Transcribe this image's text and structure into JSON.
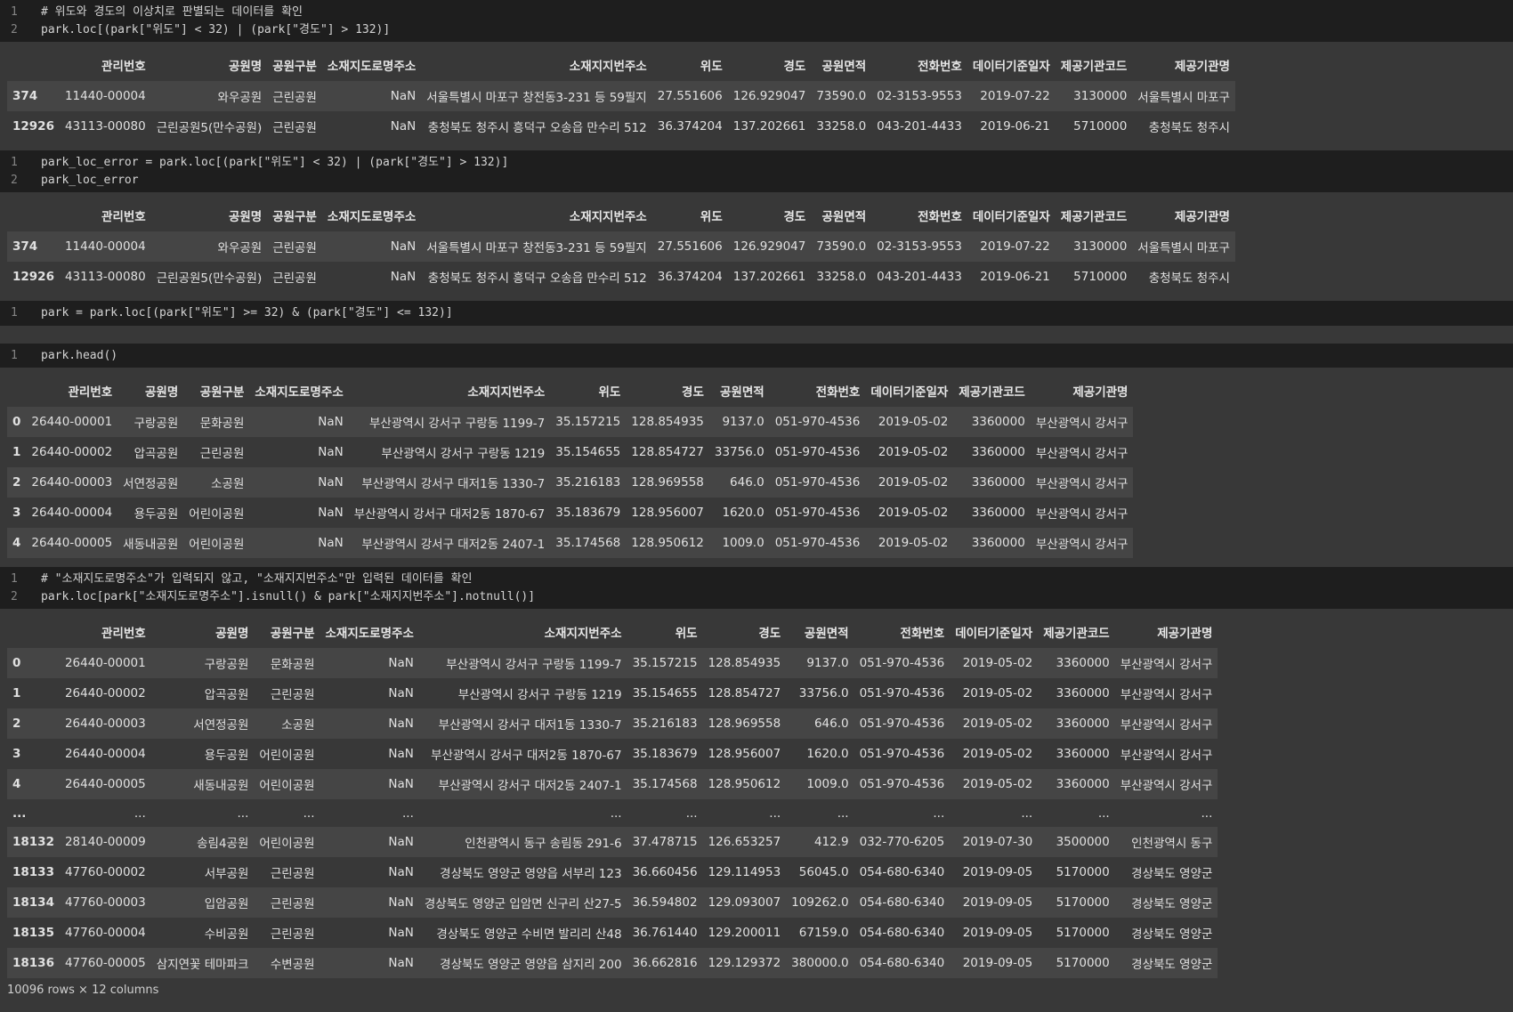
{
  "columns": [
    "관리번호",
    "공원명",
    "공원구분",
    "소재지도로명주소",
    "소재지지번주소",
    "위도",
    "경도",
    "공원면적",
    "전화번호",
    "데이터기준일자",
    "제공기관코드",
    "제공기관명"
  ],
  "cells": [
    {
      "code": [
        {
          "n": "1",
          "t": "# 위도와 경도의 이상치로 판별되는 데이터를 확인"
        },
        {
          "n": "2",
          "t": "park.loc[(park[\"위도\"] < 32) | (park[\"경도\"] > 132)]"
        }
      ],
      "rows": [
        [
          "374",
          "11440-00004",
          "와우공원",
          "근린공원",
          "NaN",
          "서울특별시 마포구 창전동3-231 등 59필지",
          "27.551606",
          "126.929047",
          "73590.0",
          "02-3153-9553",
          "2019-07-22",
          "3130000",
          "서울특별시 마포구"
        ],
        [
          "12926",
          "43113-00080",
          "근린공원5(만수공원)",
          "근린공원",
          "NaN",
          "충청북도 청주시 흥덕구 오송읍 만수리 512",
          "36.374204",
          "137.202661",
          "33258.0",
          "043-201-4433",
          "2019-06-21",
          "5710000",
          "충청북도 청주시"
        ]
      ]
    },
    {
      "code": [
        {
          "n": "1",
          "t": "park_loc_error = park.loc[(park[\"위도\"] < 32) | (park[\"경도\"] > 132)]"
        },
        {
          "n": "2",
          "t": "park_loc_error"
        }
      ],
      "rows": [
        [
          "374",
          "11440-00004",
          "와우공원",
          "근린공원",
          "NaN",
          "서울특별시 마포구 창전동3-231 등 59필지",
          "27.551606",
          "126.929047",
          "73590.0",
          "02-3153-9553",
          "2019-07-22",
          "3130000",
          "서울특별시 마포구"
        ],
        [
          "12926",
          "43113-00080",
          "근린공원5(만수공원)",
          "근린공원",
          "NaN",
          "충청북도 청주시 흥덕구 오송읍 만수리 512",
          "36.374204",
          "137.202661",
          "33258.0",
          "043-201-4433",
          "2019-06-21",
          "5710000",
          "충청북도 청주시"
        ]
      ]
    },
    {
      "code": [
        {
          "n": "1",
          "t": "park = park.loc[(park[\"위도\"] >= 32) & (park[\"경도\"] <= 132)]"
        }
      ]
    },
    {
      "code": [
        {
          "n": "1",
          "t": "park.head()"
        }
      ],
      "rows": [
        [
          "0",
          "26440-00001",
          "구랑공원",
          "문화공원",
          "NaN",
          "부산광역시 강서구 구랑동 1199-7",
          "35.157215",
          "128.854935",
          "9137.0",
          "051-970-4536",
          "2019-05-02",
          "3360000",
          "부산광역시 강서구"
        ],
        [
          "1",
          "26440-00002",
          "압곡공원",
          "근린공원",
          "NaN",
          "부산광역시 강서구 구랑동 1219",
          "35.154655",
          "128.854727",
          "33756.0",
          "051-970-4536",
          "2019-05-02",
          "3360000",
          "부산광역시 강서구"
        ],
        [
          "2",
          "26440-00003",
          "서연정공원",
          "소공원",
          "NaN",
          "부산광역시 강서구 대저1동 1330-7",
          "35.216183",
          "128.969558",
          "646.0",
          "051-970-4536",
          "2019-05-02",
          "3360000",
          "부산광역시 강서구"
        ],
        [
          "3",
          "26440-00004",
          "용두공원",
          "어린이공원",
          "NaN",
          "부산광역시 강서구 대저2동 1870-67",
          "35.183679",
          "128.956007",
          "1620.0",
          "051-970-4536",
          "2019-05-02",
          "3360000",
          "부산광역시 강서구"
        ],
        [
          "4",
          "26440-00005",
          "새동내공원",
          "어린이공원",
          "NaN",
          "부산광역시 강서구 대저2동 2407-1",
          "35.174568",
          "128.950612",
          "1009.0",
          "051-970-4536",
          "2019-05-02",
          "3360000",
          "부산광역시 강서구"
        ]
      ]
    },
    {
      "code": [
        {
          "n": "1",
          "t": "# \"소재지도로명주소\"가 입력되지 않고, \"소재지지번주소\"만 입력된 데이터를 확인"
        },
        {
          "n": "2",
          "t": "park.loc[park[\"소재지도로명주소\"].isnull() & park[\"소재지지번주소\"].notnull()]"
        }
      ],
      "rows": [
        [
          "0",
          "26440-00001",
          "구랑공원",
          "문화공원",
          "NaN",
          "부산광역시 강서구 구랑동 1199-7",
          "35.157215",
          "128.854935",
          "9137.0",
          "051-970-4536",
          "2019-05-02",
          "3360000",
          "부산광역시 강서구"
        ],
        [
          "1",
          "26440-00002",
          "압곡공원",
          "근린공원",
          "NaN",
          "부산광역시 강서구 구랑동 1219",
          "35.154655",
          "128.854727",
          "33756.0",
          "051-970-4536",
          "2019-05-02",
          "3360000",
          "부산광역시 강서구"
        ],
        [
          "2",
          "26440-00003",
          "서연정공원",
          "소공원",
          "NaN",
          "부산광역시 강서구 대저1동 1330-7",
          "35.216183",
          "128.969558",
          "646.0",
          "051-970-4536",
          "2019-05-02",
          "3360000",
          "부산광역시 강서구"
        ],
        [
          "3",
          "26440-00004",
          "용두공원",
          "어린이공원",
          "NaN",
          "부산광역시 강서구 대저2동 1870-67",
          "35.183679",
          "128.956007",
          "1620.0",
          "051-970-4536",
          "2019-05-02",
          "3360000",
          "부산광역시 강서구"
        ],
        [
          "4",
          "26440-00005",
          "새동내공원",
          "어린이공원",
          "NaN",
          "부산광역시 강서구 대저2동 2407-1",
          "35.174568",
          "128.950612",
          "1009.0",
          "051-970-4536",
          "2019-05-02",
          "3360000",
          "부산광역시 강서구"
        ],
        [
          "...",
          "...",
          "...",
          "...",
          "...",
          "...",
          "...",
          "...",
          "...",
          "...",
          "...",
          "...",
          "..."
        ],
        [
          "18132",
          "28140-00009",
          "송림4공원",
          "어린이공원",
          "NaN",
          "인천광역시 동구 송림동 291-6",
          "37.478715",
          "126.653257",
          "412.9",
          "032-770-6205",
          "2019-07-30",
          "3500000",
          "인천광역시 동구"
        ],
        [
          "18133",
          "47760-00002",
          "서부공원",
          "근린공원",
          "NaN",
          "경상북도 영양군 영양읍 서부리 123",
          "36.660456",
          "129.114953",
          "56045.0",
          "054-680-6340",
          "2019-09-05",
          "5170000",
          "경상북도 영양군"
        ],
        [
          "18134",
          "47760-00003",
          "입암공원",
          "근린공원",
          "NaN",
          "경상북도 영양군 입암면 신구리 산27-5",
          "36.594802",
          "129.093007",
          "109262.0",
          "054-680-6340",
          "2019-09-05",
          "5170000",
          "경상북도 영양군"
        ],
        [
          "18135",
          "47760-00004",
          "수비공원",
          "근린공원",
          "NaN",
          "경상북도 영양군 수비면 발리리 산48",
          "36.761440",
          "129.200011",
          "67159.0",
          "054-680-6340",
          "2019-09-05",
          "5170000",
          "경상북도 영양군"
        ],
        [
          "18136",
          "47760-00005",
          "삼지연꽃 테마파크",
          "수변공원",
          "NaN",
          "경상북도 영양군 영양읍 삼지리 200",
          "36.662816",
          "129.129372",
          "380000.0",
          "054-680-6340",
          "2019-09-05",
          "5170000",
          "경상북도 영양군"
        ]
      ],
      "shape": "10096 rows × 12 columns"
    }
  ]
}
